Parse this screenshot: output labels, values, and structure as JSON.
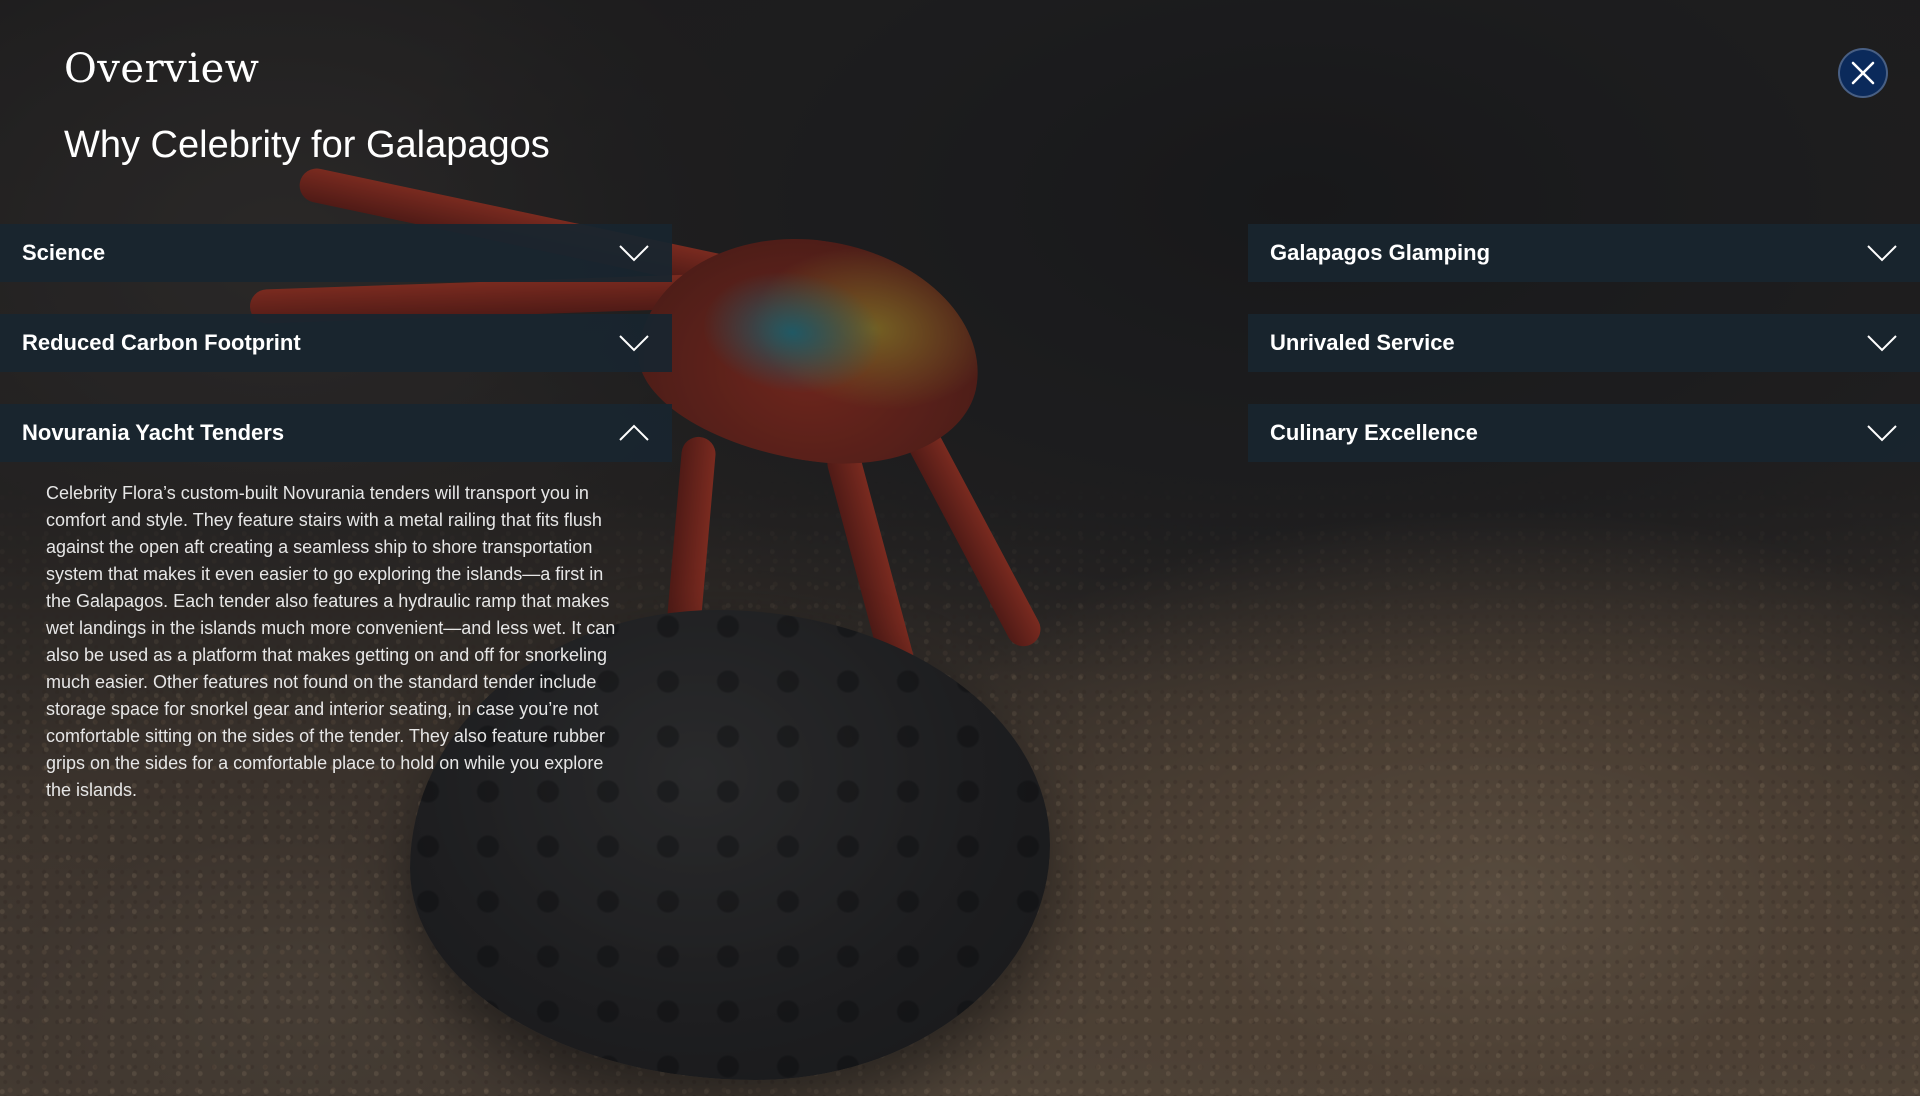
{
  "header": {
    "eyebrow": "Overview",
    "title": "Why Celebrity for Galapagos"
  },
  "close_button": {
    "icon": "close-icon",
    "color": "#0b2a5b"
  },
  "accordion": {
    "left": [
      {
        "label": "Science",
        "expanded": false,
        "icon": "chevron-down-icon"
      },
      {
        "label": "Reduced Carbon Footprint",
        "expanded": false,
        "icon": "chevron-down-icon"
      },
      {
        "label": "Novurania Yacht Tenders",
        "expanded": true,
        "icon": "chevron-up-icon",
        "body": "Celebrity Flora’s custom-built Novurania tenders will transport you in comfort and style. They feature stairs with a metal railing that fits flush against the open aft creating a seamless ship to shore transportation system that makes it even easier to go exploring the islands—a first in the Galapagos. Each tender also features a hydraulic ramp that makes wet landings in the islands much more convenient—and less wet. It can also be used as a platform that makes getting on and off for snorkeling much easier. Other features not found on the standard tender include storage space for snorkel gear and interior seating, in case you’re not comfortable sitting on the sides of the tender. They also feature rubber grips on the sides for a comfortable place to hold on while you explore the islands."
      }
    ],
    "right": [
      {
        "label": "Galapagos Glamping",
        "expanded": false,
        "icon": "chevron-down-icon"
      },
      {
        "label": "Unrivaled Service",
        "expanded": false,
        "icon": "chevron-down-icon"
      },
      {
        "label": "Culinary Excellence",
        "expanded": false,
        "icon": "chevron-down-icon"
      }
    ]
  },
  "colors": {
    "accordion_header_bg": "#18252f",
    "close_button_bg": "#0b2a5b",
    "text": "#ffffff"
  }
}
